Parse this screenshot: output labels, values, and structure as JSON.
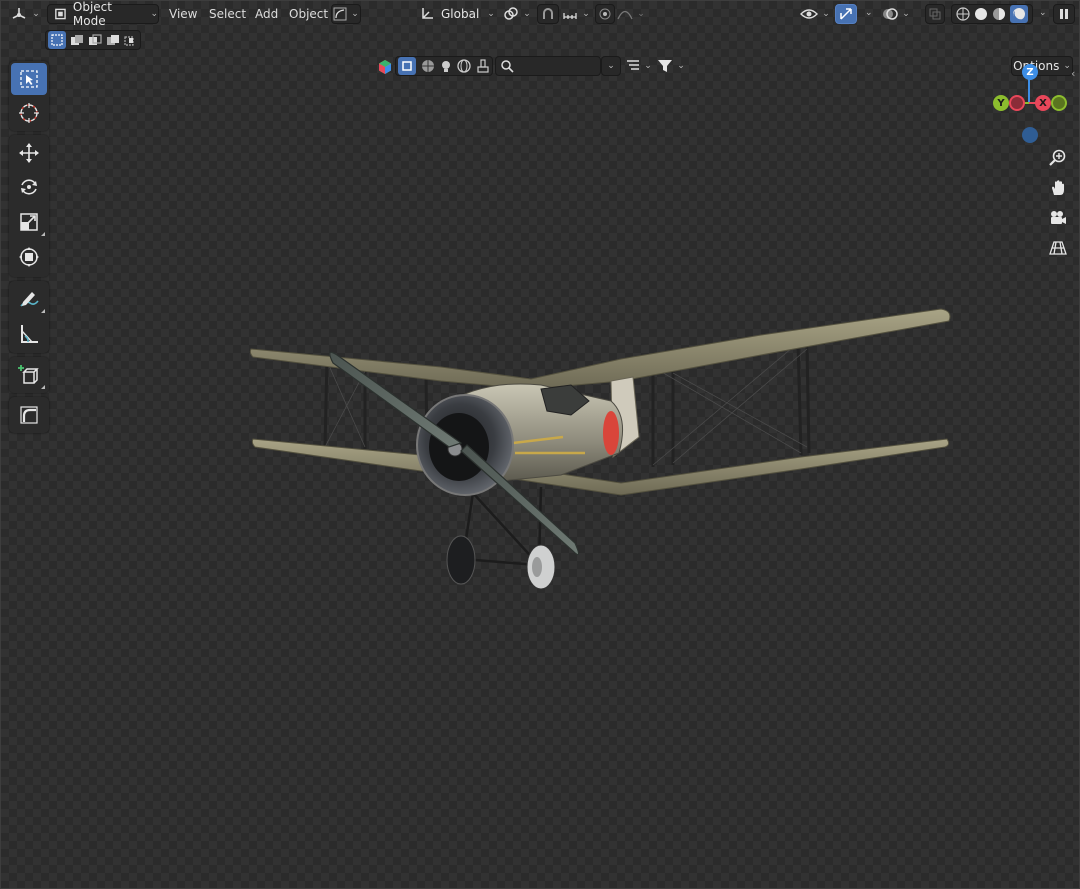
{
  "header": {
    "editor_type_icon": "3d-viewport-icon",
    "mode_label": "Object Mode",
    "menus": [
      "View",
      "Select",
      "Add",
      "Object"
    ],
    "transform_orientation": "Global",
    "options_label": "Options"
  },
  "search": {
    "placeholder": ""
  },
  "gizmo": {
    "z": "Z",
    "y": "Y",
    "x": "X"
  },
  "toolbar": {
    "tools": [
      {
        "name": "select-box",
        "icon": "select-box-icon",
        "active": true
      },
      {
        "name": "cursor",
        "icon": "cursor-icon"
      },
      {
        "name": "move",
        "icon": "move-icon"
      },
      {
        "name": "rotate",
        "icon": "rotate-icon"
      },
      {
        "name": "scale",
        "icon": "scale-icon"
      },
      {
        "name": "transform",
        "icon": "transform-icon"
      },
      {
        "name": "annotate",
        "icon": "annotate-icon"
      },
      {
        "name": "measure",
        "icon": "measure-icon"
      },
      {
        "name": "add-cube",
        "icon": "add-cube-icon"
      },
      {
        "name": "bevel",
        "icon": "bevel-icon"
      }
    ]
  },
  "colors": {
    "accent": "#4772b3",
    "axis_x": "#e8475a",
    "axis_y": "#8cbd2e",
    "axis_z": "#3d8ee6",
    "insignia_red": "#d9453a"
  }
}
